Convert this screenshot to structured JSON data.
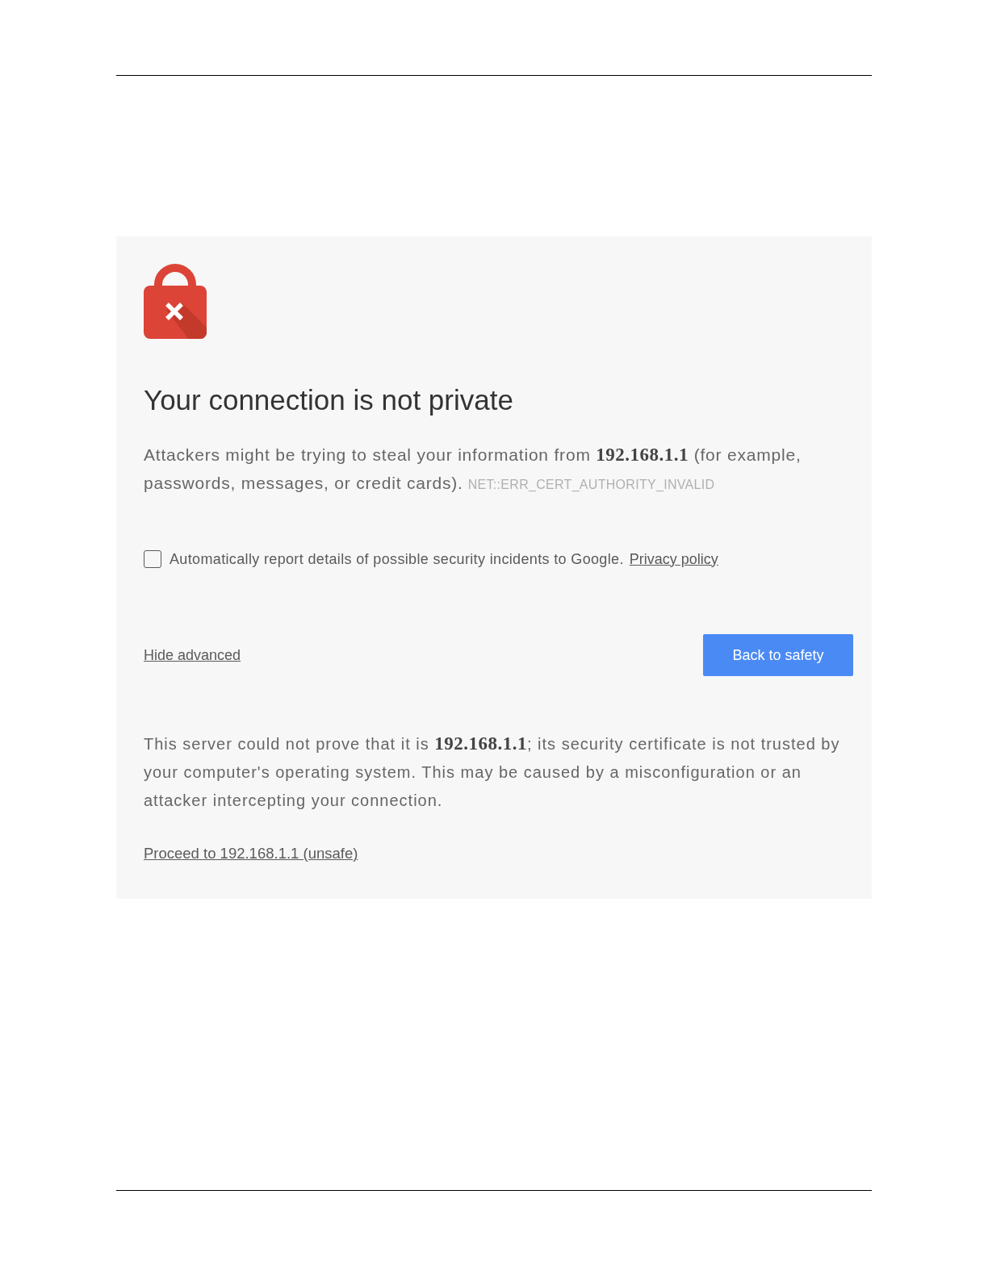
{
  "heading": "Your connection is not private",
  "intro": {
    "text": "Attackers might be trying to steal your information from **192.168.1.1** (for example, passwords, messages, or credit cards).",
    "error_code": "NET::ERR_CERT_AUTHORITY_INVALID"
  },
  "report_option": {
    "checked": false,
    "label": "Automatically report details of possible security incidents to Google.",
    "link": "Privacy policy"
  },
  "advanced_link": "Hide advanced",
  "primary_button": "Back to safety",
  "details": "This server could not prove that it is **192.168.1.1**; its security certificate is not trusted by your computer's operating system. This may be caused by a misconfiguration or an attacker intercepting your connection.",
  "proceed_link": "Proceed to 192.168.1.1 (unsafe)"
}
